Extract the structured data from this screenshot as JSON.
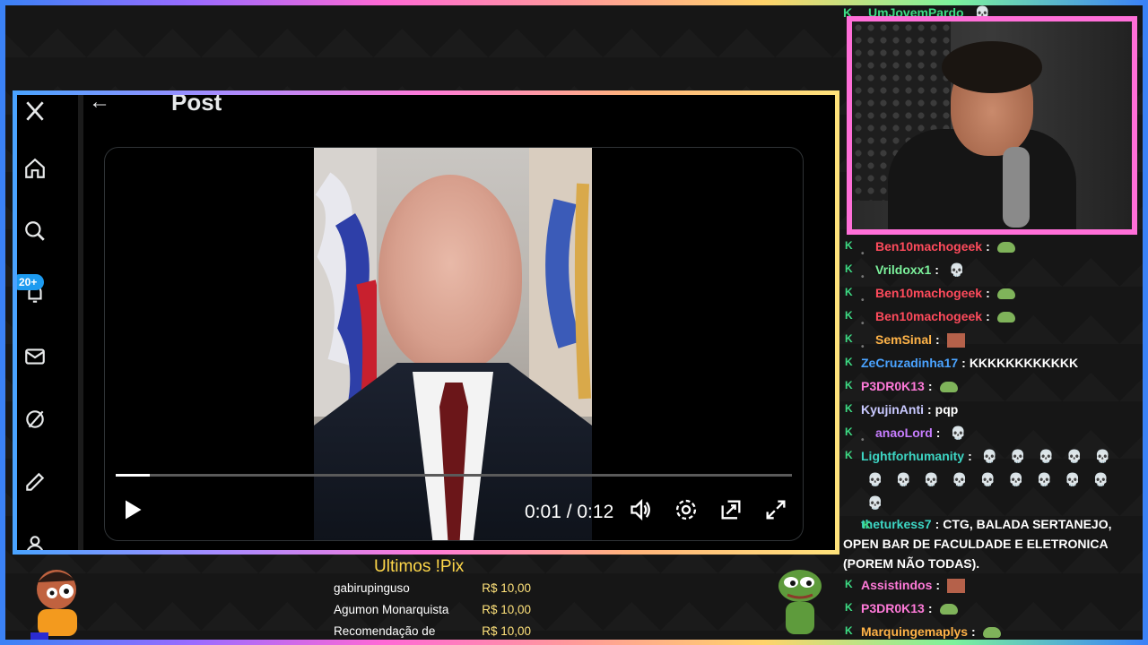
{
  "post": {
    "back_label": "←",
    "title": "Post"
  },
  "sidebar": {
    "notification_badge": "20+",
    "icons": [
      "x-logo-icon",
      "home-icon",
      "search-icon",
      "notifications-icon",
      "messages-icon",
      "grok-icon",
      "edit-icon",
      "profile-icon"
    ]
  },
  "video": {
    "time": "0:01 / 0:12",
    "progress": 0.05,
    "controls": [
      "play-icon",
      "volume-icon",
      "settings-icon",
      "picture-in-picture-icon",
      "fullscreen-icon"
    ]
  },
  "chat": {
    "top_partial": {
      "user": "UmJovemPardo",
      "color": "#3ddc84"
    },
    "messages": [
      {
        "user": "Ben10machogeek",
        "color": "#ff4b5c",
        "sub": true,
        "text": "",
        "emotes": [
          "frog"
        ]
      },
      {
        "user": "Vrildoxx1",
        "color": "#7cf29c",
        "sub": true,
        "text": "",
        "emotes": [
          "skull"
        ]
      },
      {
        "user": "Ben10machogeek",
        "color": "#ff4b5c",
        "sub": true,
        "text": "",
        "emotes": [
          "frog"
        ]
      },
      {
        "user": "Ben10machogeek",
        "color": "#ff4b5c",
        "sub": true,
        "text": "",
        "emotes": [
          "frog"
        ]
      },
      {
        "user": "SemSinal",
        "color": "#ffb347",
        "sub": true,
        "text": "",
        "emotes": [
          "face"
        ]
      },
      {
        "user": "ZeCruzadinha17",
        "color": "#4aa3ff",
        "sub": false,
        "text": "KKKKKKKKKKKK",
        "emotes": []
      },
      {
        "user": "P3DR0K13",
        "color": "#ff7ad9",
        "sub": false,
        "text": "",
        "emotes": [
          "frog"
        ]
      },
      {
        "user": "KyujinAnti",
        "color": "#c9c9ff",
        "sub": false,
        "text": "pqp",
        "emotes": []
      },
      {
        "user": "anaoLord",
        "color": "#c77dff",
        "sub": true,
        "text": "",
        "emotes": [
          "skull"
        ]
      },
      {
        "user": "Lightforhumanity",
        "color": "#3dd6c4",
        "sub": false,
        "text": "",
        "emotes": [
          "skull",
          "skull",
          "skull",
          "skull",
          "skull",
          "skull",
          "skull",
          "skull",
          "skull",
          "skull",
          "skull",
          "skull",
          "skull",
          "skull",
          "skull"
        ]
      },
      {
        "user": "theturkess7",
        "color": "#3dd6c4",
        "sub": false,
        "text": "CTG, BALADA SERTANEJO, OPEN BAR DE FACULDADE E ELETRONICA (POREM NÃO TODAS).",
        "emotes": []
      },
      {
        "user": "Assistindos",
        "color": "#ff7ad9",
        "sub": false,
        "text": "",
        "emotes": [
          "face"
        ]
      },
      {
        "user": "P3DR0K13",
        "color": "#ff7ad9",
        "sub": false,
        "text": "",
        "emotes": [
          "frog"
        ]
      },
      {
        "user": "Marquingemaplys",
        "color": "#ffb347",
        "sub": false,
        "text": "",
        "emotes": [
          "frog"
        ]
      }
    ]
  },
  "pix": {
    "title": "Ultimos !Pix",
    "entries": [
      {
        "name": "gabirupinguso",
        "value": "R$ 10,00"
      },
      {
        "name": "Agumon Monarquista",
        "value": "R$ 10,00"
      },
      {
        "name": "Recomendação de",
        "value": "R$ 10,00"
      }
    ]
  }
}
